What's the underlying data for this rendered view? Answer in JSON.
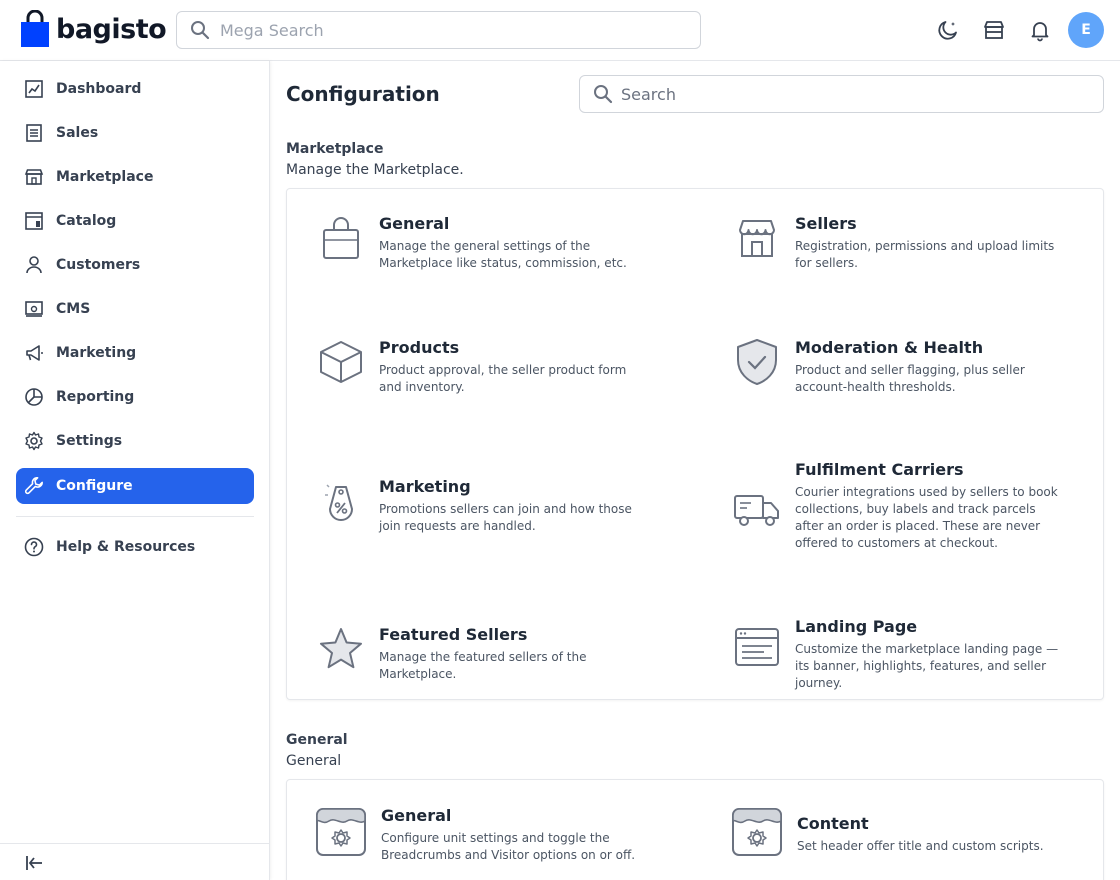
{
  "header": {
    "logo_text": "bagisto",
    "search_placeholder": "Mega Search",
    "avatar_initial": "E"
  },
  "sidebar": {
    "items": [
      {
        "label": "Dashboard",
        "icon": "dashboard-icon"
      },
      {
        "label": "Sales",
        "icon": "sales-icon"
      },
      {
        "label": "Marketplace",
        "icon": "marketplace-icon"
      },
      {
        "label": "Catalog",
        "icon": "catalog-icon"
      },
      {
        "label": "Customers",
        "icon": "customers-icon"
      },
      {
        "label": "CMS",
        "icon": "cms-icon"
      },
      {
        "label": "Marketing",
        "icon": "marketing-icon"
      },
      {
        "label": "Reporting",
        "icon": "reporting-icon"
      },
      {
        "label": "Settings",
        "icon": "settings-icon"
      },
      {
        "label": "Configure",
        "icon": "configure-icon",
        "active": true
      }
    ],
    "help_label": "Help & Resources"
  },
  "main": {
    "title": "Configuration",
    "search_placeholder": "Search",
    "sections": [
      {
        "title": "Marketplace",
        "description": "Manage the Marketplace.",
        "cards": [
          {
            "title": "General",
            "description": "Manage the general settings of the Marketplace like status, commission, etc.",
            "icon": "shopping-bag-icon"
          },
          {
            "title": "Sellers",
            "description": "Registration, permissions and upload limits for sellers.",
            "icon": "storefront-icon"
          },
          {
            "title": "Products",
            "description": "Product approval, the seller product form and inventory.",
            "icon": "box-icon"
          },
          {
            "title": "Moderation & Health",
            "description": "Product and seller flagging, plus seller account-health thresholds.",
            "icon": "shield-check-icon"
          },
          {
            "title": "Marketing",
            "description": "Promotions sellers can join and how those join requests are handled.",
            "icon": "discount-tag-icon"
          },
          {
            "title": "Fulfilment Carriers",
            "description": "Courier integrations used by sellers to book collections, buy labels and track parcels after an order is placed. These are never offered to customers at checkout.",
            "icon": "delivery-truck-icon"
          },
          {
            "title": "Featured Sellers",
            "description": "Manage the featured sellers of the Marketplace.",
            "icon": "star-icon"
          },
          {
            "title": "Landing Page",
            "description": "Customize the marketplace landing page — its banner, highlights, features, and seller journey.",
            "icon": "browser-window-icon"
          }
        ]
      },
      {
        "title": "General",
        "description": "General",
        "cards": [
          {
            "title": "General",
            "description": "Configure unit settings and toggle the Breadcrumbs and Visitor options on or off.",
            "icon": "settings-store-icon"
          },
          {
            "title": "Content",
            "description": "Set header offer title and custom scripts.",
            "icon": "settings-store-icon"
          }
        ]
      }
    ]
  },
  "colors": {
    "accent": "#2563eb",
    "avatar": "#60a5fa",
    "icon_stroke": "#6b7280"
  }
}
